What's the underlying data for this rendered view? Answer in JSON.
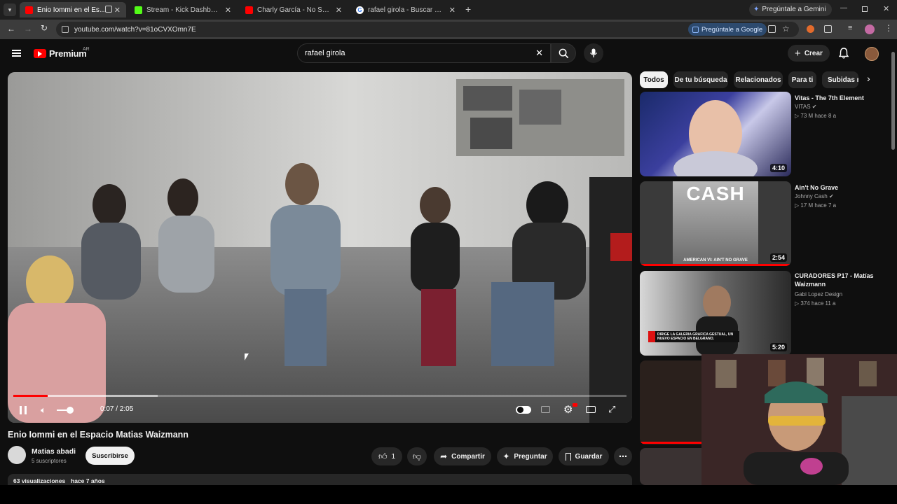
{
  "browser": {
    "tabs": [
      {
        "label": "Enio Iommi en el Espacio M",
        "color": "#ff0000",
        "active": true
      },
      {
        "label": "Stream - Kick Dashboard",
        "color": "#53fc18",
        "active": false
      },
      {
        "label": "Charly García - No Soy Un Extr",
        "color": "#ff0000",
        "active": false
      },
      {
        "label": "rafael girola - Buscar con Goog",
        "color": "#4285f4",
        "active": false
      }
    ],
    "gemini_label": "Pregúntale a Gemini",
    "url": "youtube.com/watch?v=81oCVXOmn7E",
    "ask_google_label": "Pregúntale a Google"
  },
  "youtube": {
    "logo": "Premium",
    "region": "AR",
    "search_value": "rafael girola",
    "create_label": "Crear"
  },
  "player": {
    "time": "0:07 / 2:05",
    "progress_fraction": 0.056
  },
  "video": {
    "title": "Enio Iommi en el Espacio Matias Waizmann",
    "channel": "Matias abadi",
    "subscribers": "5 suscriptores",
    "subscribe_label": "Suscribirse",
    "likes": "1",
    "share_label": "Compartir",
    "ask_label": "Preguntar",
    "save_label": "Guardar",
    "views": "63 visualizaciones",
    "age": "hace 7 años"
  },
  "chips": [
    "Todos",
    "De tu búsqueda",
    "Relacionados",
    "Para ti",
    "Subidas re"
  ],
  "recommendations": [
    {
      "title": "Vitas - The 7th Element",
      "channel": "VITAS",
      "meta": "73 M  hace 8 a",
      "duration": "4:10"
    },
    {
      "title": "Ain't No Grave",
      "channel": "Johnny Cash",
      "meta": "17 M  hace 7 a",
      "duration": "2:54",
      "thumb_text": "CASH",
      "thumb_sub": "AMERICAN VI: AIN'T NO GRAVE"
    },
    {
      "title": "CURADORES P17 - Matías Waizmann",
      "channel": "Gabi Lopez Design",
      "meta": "374  hace 11 a",
      "duration": "5:20",
      "thumb_caption": "DIRIGE LA GALERIA GRAFICA GESTUAL, UN NUEVO ESPACIO EN BELGRANO."
    }
  ]
}
